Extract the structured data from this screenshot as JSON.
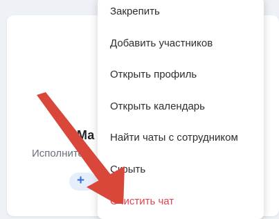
{
  "profile": {
    "name": "Ма",
    "role": "Исполнитель",
    "add_label": "+"
  },
  "context_menu": {
    "items": [
      {
        "label": "Закрепить"
      },
      {
        "label": "Добавить участников"
      },
      {
        "label": "Открыть профиль"
      },
      {
        "label": "Открыть календарь"
      },
      {
        "label": "Найти чаты с сотрудником"
      },
      {
        "label": "Скрыть"
      },
      {
        "label": "Очистить чат"
      }
    ]
  },
  "colors": {
    "accent": "#2f6fde",
    "danger": "#e0434f",
    "annotation_arrow": "#d9473b"
  }
}
